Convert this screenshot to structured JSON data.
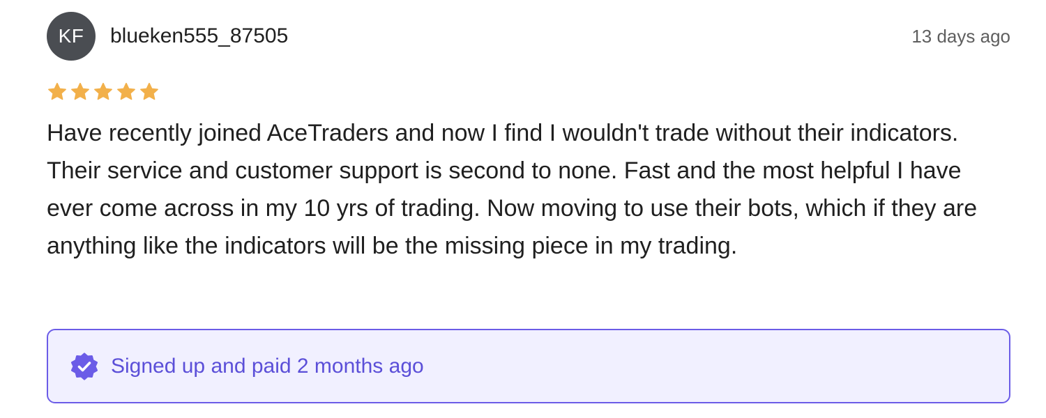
{
  "review": {
    "avatar_initials": "KF",
    "username": "blueken555_87505",
    "time_ago": "13 days ago",
    "rating": 5,
    "rating_max": 5,
    "star_color": "#f2b04a",
    "text": "Have recently joined AceTraders and now I find I wouldn't trade without their indicators. Their service and customer support is second to none. Fast and the most helpful I have ever come across in my 10 yrs of trading. Now moving to use their bots, which if they are anything like the indicators will be the missing piece in my trading.",
    "verified": {
      "icon": "verified-check-badge-icon",
      "label": "Signed up and paid 2 months ago",
      "accent_color": "#6b5ce7"
    }
  }
}
